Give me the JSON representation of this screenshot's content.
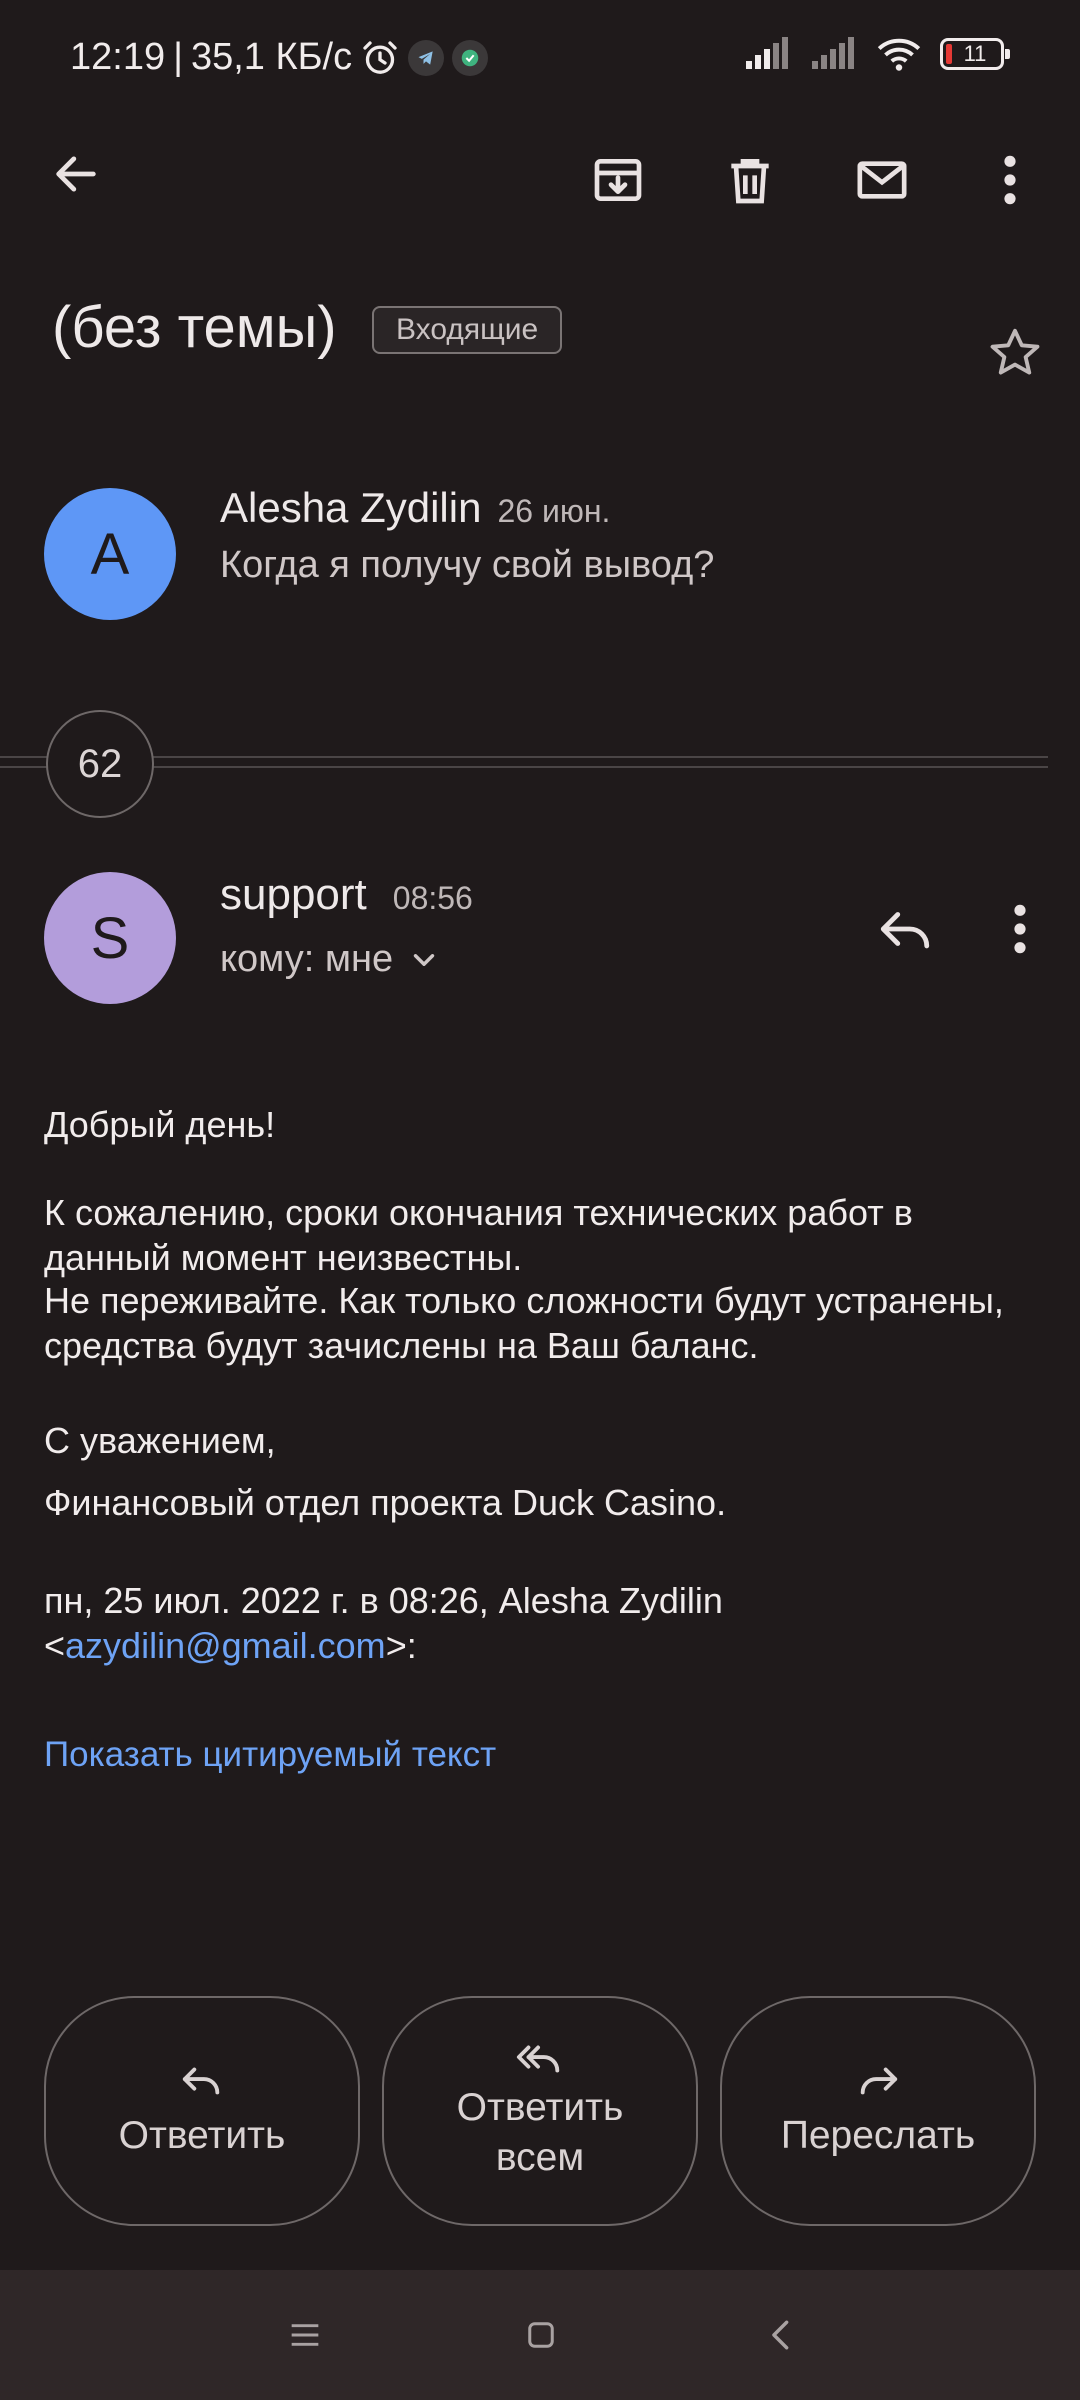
{
  "status_bar": {
    "time": "12:19",
    "separator": "|",
    "speed": "35,1 КБ/с",
    "battery": "11"
  },
  "toolbar": {
    "back": "back-arrow-icon",
    "archive": "archive-icon",
    "delete": "delete-icon",
    "mark_unread": "mail-icon",
    "more": "more-vert-icon"
  },
  "thread": {
    "subject": "(без темы)",
    "label": "Входящие",
    "collapsed_count": "62"
  },
  "first_message": {
    "avatar_letter": "A",
    "avatar_color": "#5e97f6",
    "sender": "Alesha Zydilin",
    "date": "26 июн.",
    "snippet": "Когда я получу свой вывод?"
  },
  "open_message": {
    "avatar_letter": "S",
    "avatar_color": "#b39ddb",
    "sender": "support",
    "time": "08:56",
    "recipient_line": "кому: мне",
    "greeting": "Добрый день!",
    "paragraph1": "К сожалению, сроки окончания технических работ в данный момент неизвестны.",
    "paragraph2": "Не переживайте. Как только сложности будут устранены, средства будут зачислены на Ваш баланс.",
    "signoff": "С уважением,",
    "signature": "Финансовый отдел проекта Duck Casino.",
    "quote_header_start": "пн, 25 июл. 2022 г. в 08:26, Alesha Zydilin",
    "quote_email_open": "<",
    "quote_email": "azydilin@gmail.com",
    "quote_email_close": ">:",
    "show_quoted": "Показать цитируемый текст"
  },
  "actions": {
    "reply": "Ответить",
    "reply_all_line1": "Ответить",
    "reply_all_line2": "всем",
    "forward": "Переслать"
  },
  "colors": {
    "background": "#1f1a1b",
    "link": "#6ea3f5"
  }
}
